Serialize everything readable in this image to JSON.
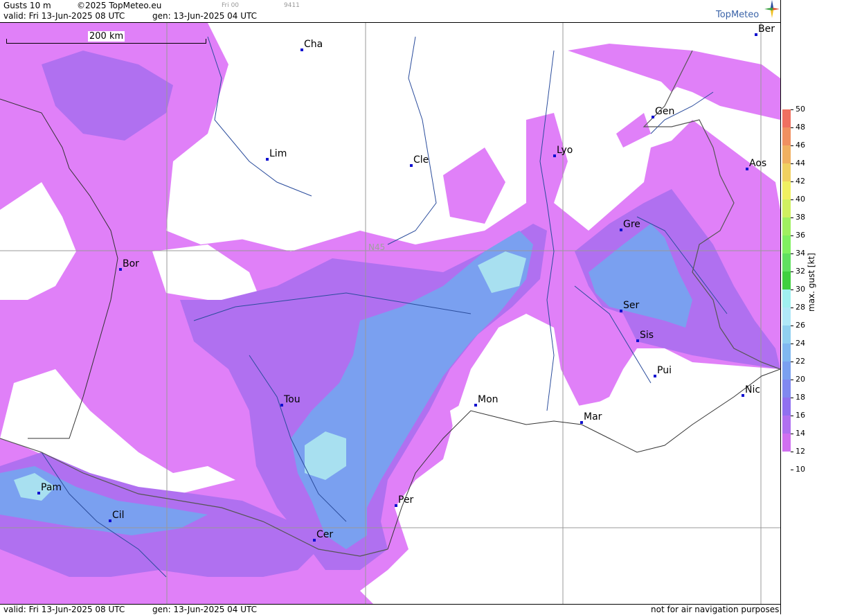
{
  "header": {
    "title": "Gusts 10 m",
    "copyright": "©2025 TopMeteo.eu",
    "valid": "valid:  Fri  13-Jun-2025  08 UTC",
    "gen": "gen: 13-Jun-2025 04 UTC",
    "run": "Fri 00",
    "code": "9411",
    "brand": "TopMeteo"
  },
  "scale": {
    "label": "200 km"
  },
  "map": {
    "latitude_label": "N45",
    "cities": [
      {
        "name": "Cha",
        "id": "cha"
      },
      {
        "name": "Ber",
        "id": "ber"
      },
      {
        "name": "Gen",
        "id": "gen"
      },
      {
        "name": "Lim",
        "id": "lim"
      },
      {
        "name": "Cle",
        "id": "cle"
      },
      {
        "name": "Lyo",
        "id": "lyo"
      },
      {
        "name": "Aos",
        "id": "aos"
      },
      {
        "name": "Gre",
        "id": "gre"
      },
      {
        "name": "Bor",
        "id": "bor"
      },
      {
        "name": "Ser",
        "id": "ser"
      },
      {
        "name": "Sis",
        "id": "sis"
      },
      {
        "name": "Pui",
        "id": "pui"
      },
      {
        "name": "Tou",
        "id": "tou"
      },
      {
        "name": "Mon",
        "id": "mon"
      },
      {
        "name": "Nic",
        "id": "nic"
      },
      {
        "name": "Mar",
        "id": "mar"
      },
      {
        "name": "Pam",
        "id": "pam"
      },
      {
        "name": "Cil",
        "id": "cil"
      },
      {
        "name": "Per",
        "id": "per"
      },
      {
        "name": "Cer",
        "id": "cer"
      }
    ]
  },
  "legend": {
    "title": "max. gust [kt]",
    "ticks": [
      "50",
      "48",
      "46",
      "44",
      "42",
      "40",
      "38",
      "36",
      "34",
      "32",
      "30",
      "28",
      "26",
      "24",
      "22",
      "20",
      "18",
      "16",
      "14",
      "12",
      "10"
    ],
    "colors": {
      "c50": "#f07060",
      "c48": "#f09060",
      "c46": "#f0b060",
      "c44": "#f0d060",
      "c42": "#f0f060",
      "c40": "#d0f060",
      "c38": "#a0f060",
      "c36": "#80f060",
      "c34": "#60e060",
      "c32": "#40d040",
      "c30": "#a0f0f0",
      "c28": "#b0e8f8",
      "c26": "#90d0f0",
      "c24": "#80b8f0",
      "c22": "#7aa0f0",
      "c20": "#8088f0",
      "c18": "#9070f0",
      "c16": "#b070f0",
      "c14": "#d070f0",
      "c12": "#e080f8"
    }
  },
  "footer": {
    "valid": "valid:  Fri  13-Jun-2025  08 UTC",
    "gen": "gen: 13-Jun-2025 04 UTC",
    "disclaimer": "not for air navigation purposes"
  }
}
